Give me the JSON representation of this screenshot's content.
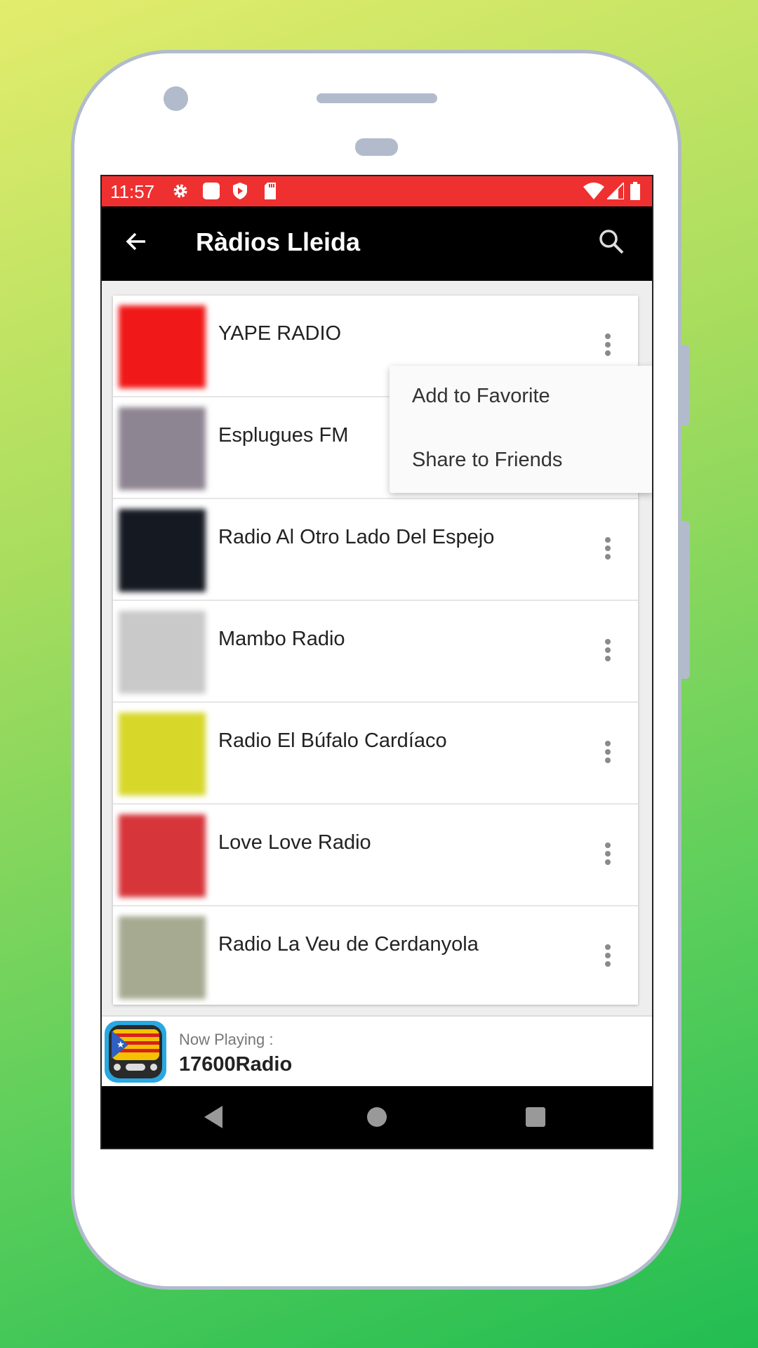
{
  "status_bar": {
    "time": "11:57",
    "left_icons": [
      "settings-icon",
      "notification-square-icon",
      "shield-play-icon",
      "sd-card-icon"
    ],
    "right_icons": [
      "wifi-icon",
      "cell-signal-icon",
      "battery-icon"
    ],
    "color": "#ef3030"
  },
  "toolbar": {
    "title": "Ràdios Lleida",
    "back_icon": "arrow-left-icon",
    "search_icon": "search-icon"
  },
  "stations": [
    {
      "name": "YAPE RADIO",
      "thumb_color": "#f01818"
    },
    {
      "name": "Esplugues FM",
      "thumb_color": "#8e8592"
    },
    {
      "name": "Radio Al Otro Lado Del Espejo",
      "thumb_color": "#151a22"
    },
    {
      "name": "Mambo Radio",
      "thumb_color": "#c9c9c9"
    },
    {
      "name": "Radio El Búfalo Cardíaco",
      "thumb_color": "#d7d72a"
    },
    {
      "name": "Love Love Radio",
      "thumb_color": "#d6353a"
    },
    {
      "name": "Radio La Veu de Cerdanyola",
      "thumb_color": "#a6aa90"
    }
  ],
  "context_menu": {
    "items": [
      "Add to Favorite",
      "Share to Friends"
    ]
  },
  "now_playing": {
    "label": "Now Playing :",
    "station": "17600Radio"
  },
  "nav_bar": {
    "buttons": [
      "back-triangle-icon",
      "home-circle-icon",
      "recents-square-icon"
    ]
  }
}
